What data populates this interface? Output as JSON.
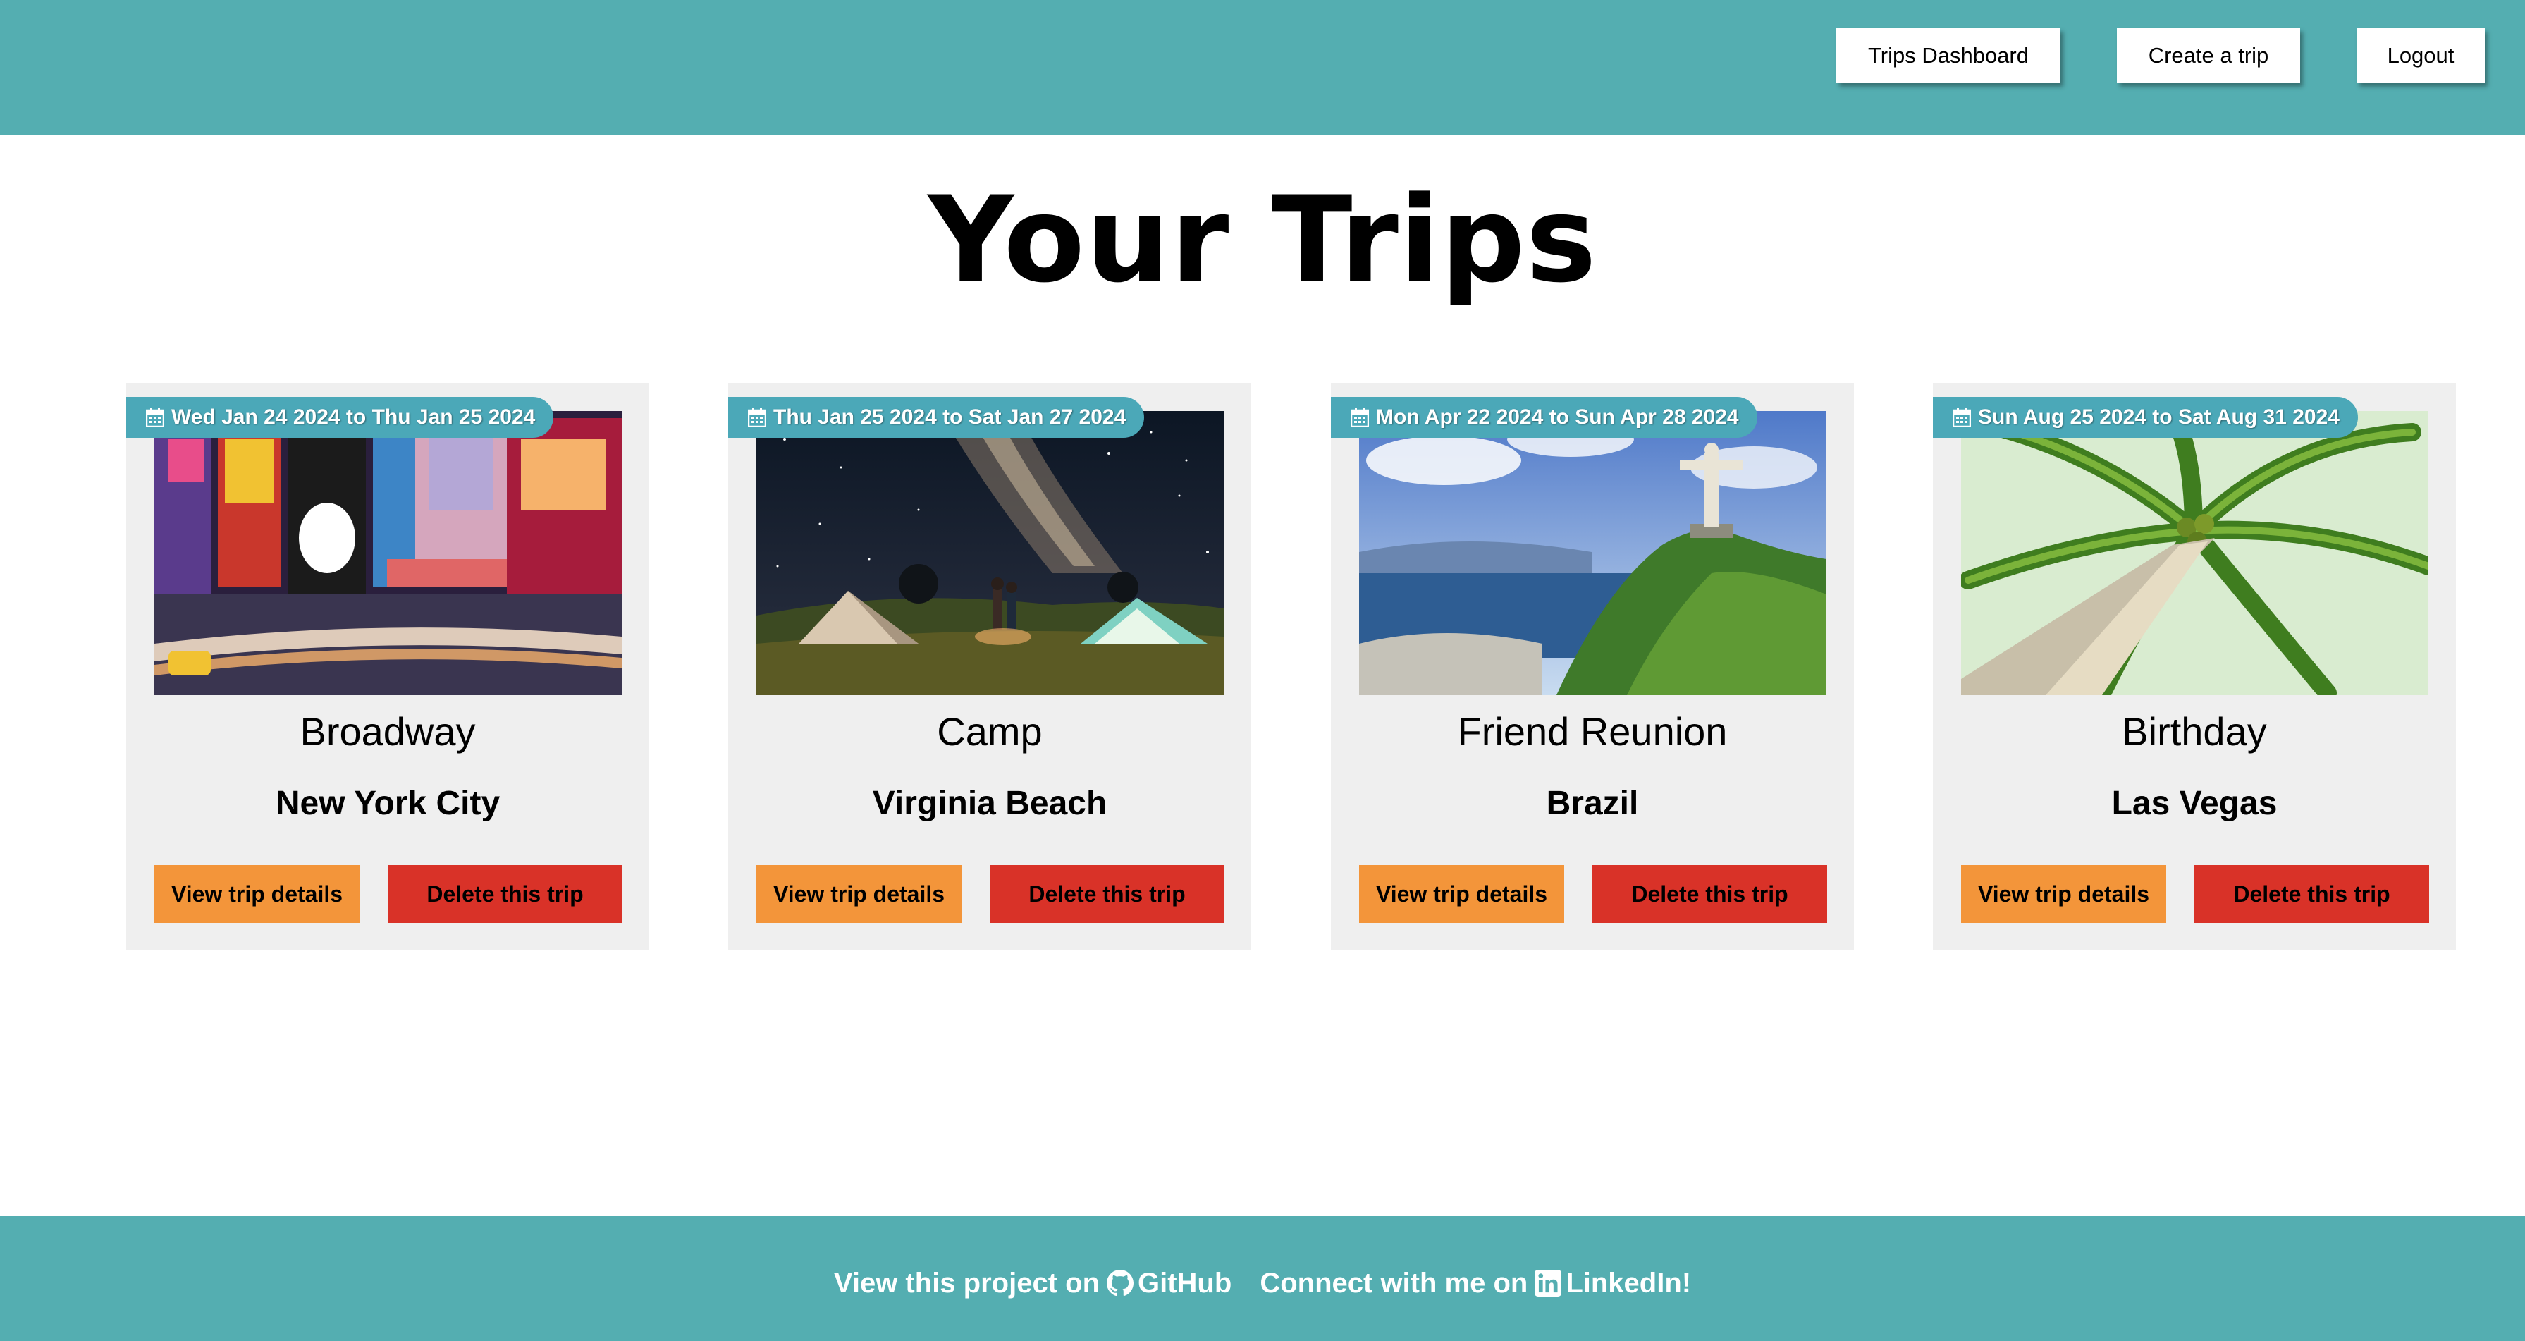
{
  "header": {
    "nav": {
      "dashboard_label": "Trips Dashboard",
      "create_label": "Create a trip",
      "logout_label": "Logout"
    },
    "background_color": "#54aeb1"
  },
  "main": {
    "title": "Your Trips",
    "trips": [
      {
        "dates": "Wed Jan 24 2024 to Thu Jan 25 2024",
        "name": "Broadway",
        "location": "New York City",
        "image": "times-square-broadway-photo",
        "view_label": "View trip details",
        "delete_label": "Delete this trip"
      },
      {
        "dates": "Thu Jan 25 2024 to Sat Jan 27 2024",
        "name": "Camp",
        "location": "Virginia Beach",
        "image": "night-camping-milky-way-photo",
        "view_label": "View trip details",
        "delete_label": "Delete this trip"
      },
      {
        "dates": "Mon Apr 22 2024 to Sun Apr 28 2024",
        "name": "Friend Reunion",
        "location": "Brazil",
        "image": "rio-christ-the-redeemer-photo",
        "view_label": "View trip details",
        "delete_label": "Delete this trip"
      },
      {
        "dates": "Sun Aug 25 2024 to Sat Aug 31 2024",
        "name": "Birthday",
        "location": "Las Vegas",
        "image": "palm-tree-from-below-photo",
        "view_label": "View trip details",
        "delete_label": "Delete this trip"
      }
    ]
  },
  "footer": {
    "github_prefix": "View this project on",
    "github_label": "GitHub",
    "github_icon": "github-icon",
    "linkedin_prefix": "Connect with me on",
    "linkedin_label": "LinkedIn!",
    "linkedin_icon": "linkedin-icon"
  },
  "colors": {
    "accent": "#54aeb1",
    "badge": "#4ba8b8",
    "view_button": "#f3953a",
    "delete_button": "#d93228",
    "card_background": "#efefef"
  }
}
